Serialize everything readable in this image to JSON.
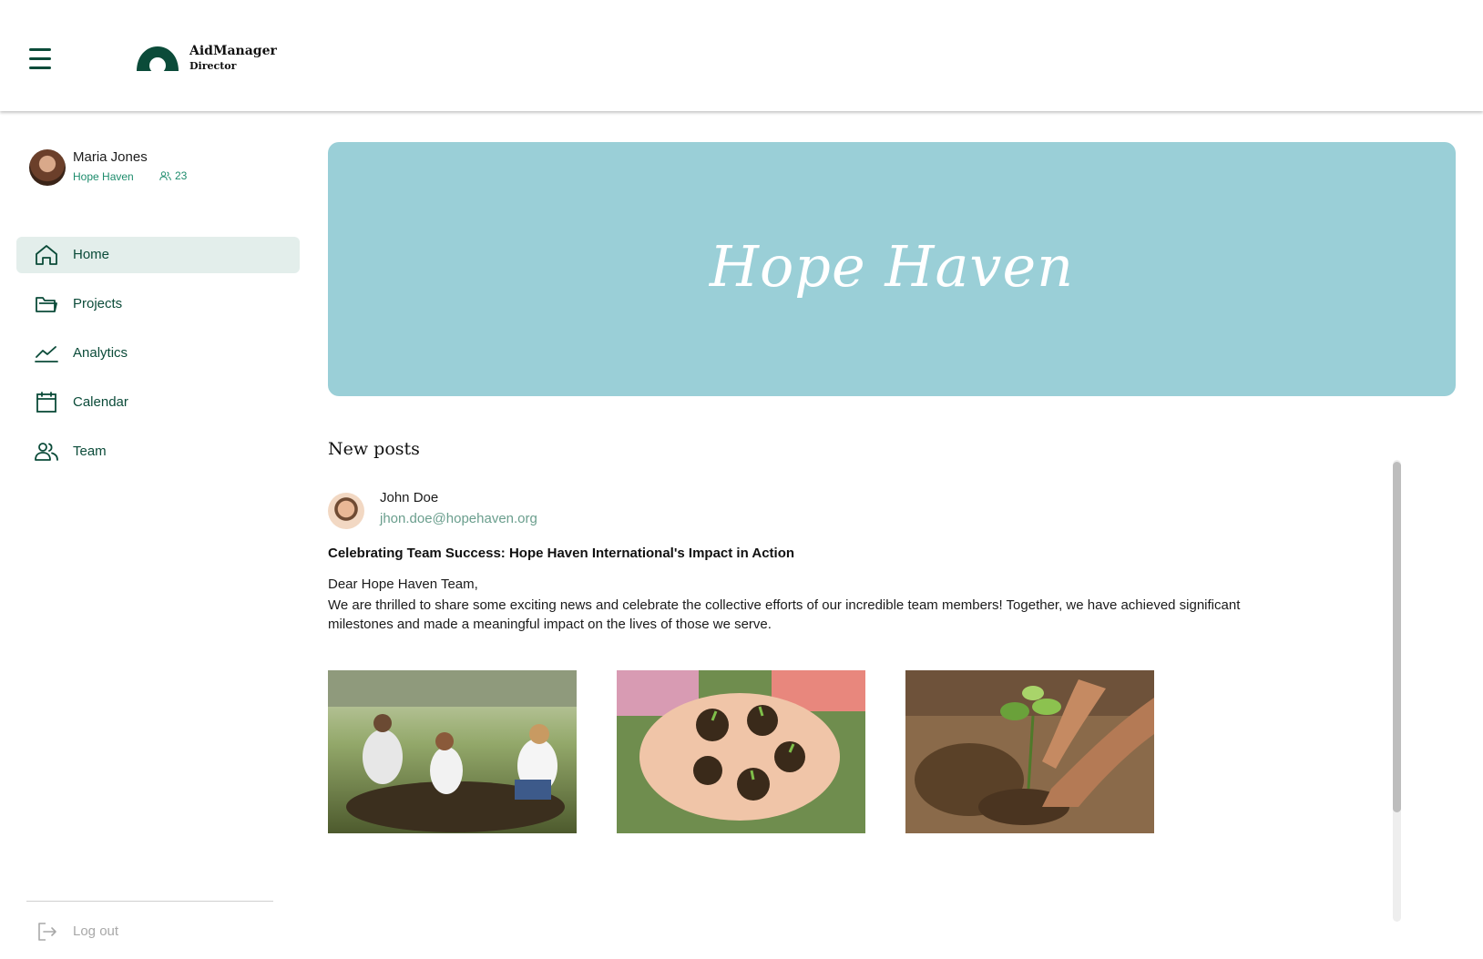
{
  "header": {
    "brand_name": "AidManager",
    "brand_role": "Director"
  },
  "profile": {
    "name": "Maria Jones",
    "organization": "Hope Haven",
    "member_count": "23"
  },
  "sidebar": {
    "items": [
      {
        "label": "Home",
        "icon": "home-icon",
        "active": true
      },
      {
        "label": "Projects",
        "icon": "folder-icon",
        "active": false
      },
      {
        "label": "Analytics",
        "icon": "chart-icon",
        "active": false
      },
      {
        "label": "Calendar",
        "icon": "calendar-icon",
        "active": false
      },
      {
        "label": "Team",
        "icon": "team-icon",
        "active": false
      }
    ],
    "logout_label": "Log out"
  },
  "banner": {
    "title": "Hope Haven",
    "color": "#9acfd7"
  },
  "posts_section": {
    "title": "New posts",
    "posts": [
      {
        "author": "John Doe",
        "email": "jhon.doe@hopehaven.org",
        "title": "Celebrating Team Success: Hope Haven International's Impact in Action",
        "greeting": "Dear Hope Haven Team,",
        "body": "We are thrilled to share some exciting news and celebrate the collective efforts of our incredible team members! Together, we have achieved significant milestones and made a meaningful impact on the lives of those we serve."
      }
    ]
  },
  "colors": {
    "accent": "#0b4b39",
    "accent_light": "#1d8c6c",
    "active_nav_bg": "#e3eeeb"
  }
}
